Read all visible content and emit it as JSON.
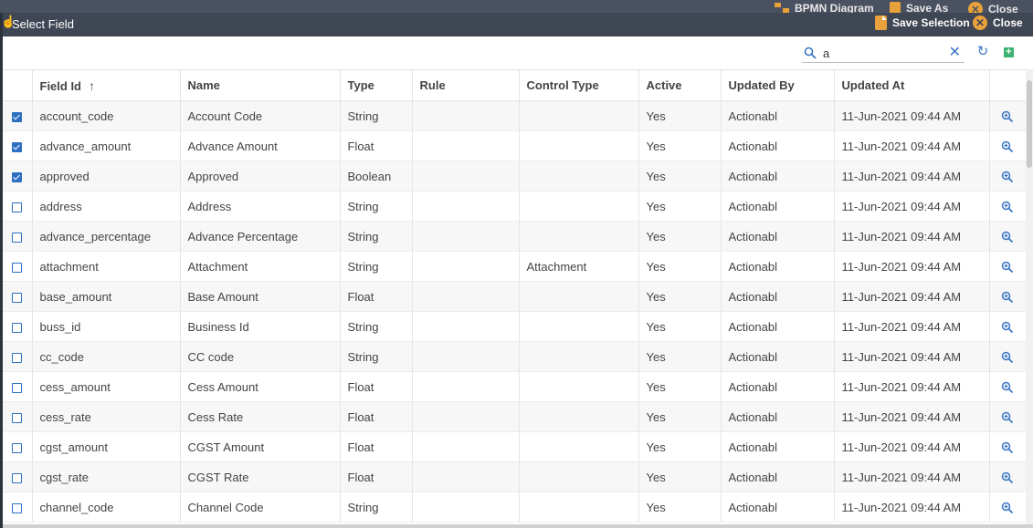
{
  "background_app": {
    "bpmn_label": "BPMN Diagram",
    "save_as_label": "Save As",
    "close_label": "Close"
  },
  "dialog": {
    "title": "Select Field",
    "save_selection_label": "Save Selection",
    "close_label": "Close"
  },
  "toolbar": {
    "search_value": "a"
  },
  "table": {
    "columns": [
      "Field Id",
      "Name",
      "Type",
      "Rule",
      "Control Type",
      "Active",
      "Updated By",
      "Updated At"
    ],
    "sorted_column": "Field Id",
    "sort_direction": "ascending",
    "rows": [
      {
        "checked": true,
        "field_id": "account_code",
        "name": "Account Code",
        "type": "String",
        "rule": "",
        "control_type": "",
        "active": "Yes",
        "updated_by": "Actionabl",
        "updated_at": "11-Jun-2021 09:44 AM"
      },
      {
        "checked": true,
        "field_id": "advance_amount",
        "name": "Advance Amount",
        "type": "Float",
        "rule": "",
        "control_type": "",
        "active": "Yes",
        "updated_by": "Actionabl",
        "updated_at": "11-Jun-2021 09:44 AM"
      },
      {
        "checked": true,
        "field_id": "approved",
        "name": "Approved",
        "type": "Boolean",
        "rule": "",
        "control_type": "",
        "active": "Yes",
        "updated_by": "Actionabl",
        "updated_at": "11-Jun-2021 09:44 AM"
      },
      {
        "checked": false,
        "field_id": "address",
        "name": "Address",
        "type": "String",
        "rule": "",
        "control_type": "",
        "active": "Yes",
        "updated_by": "Actionabl",
        "updated_at": "11-Jun-2021 09:44 AM"
      },
      {
        "checked": false,
        "field_id": "advance_percentage",
        "name": "Advance Percentage",
        "type": "String",
        "rule": "",
        "control_type": "",
        "active": "Yes",
        "updated_by": "Actionabl",
        "updated_at": "11-Jun-2021 09:44 AM"
      },
      {
        "checked": false,
        "field_id": "attachment",
        "name": "Attachment",
        "type": "String",
        "rule": "",
        "control_type": "Attachment",
        "active": "Yes",
        "updated_by": "Actionabl",
        "updated_at": "11-Jun-2021 09:44 AM"
      },
      {
        "checked": false,
        "field_id": "base_amount",
        "name": "Base Amount",
        "type": "Float",
        "rule": "",
        "control_type": "",
        "active": "Yes",
        "updated_by": "Actionabl",
        "updated_at": "11-Jun-2021 09:44 AM"
      },
      {
        "checked": false,
        "field_id": "buss_id",
        "name": "Business Id",
        "type": "String",
        "rule": "",
        "control_type": "",
        "active": "Yes",
        "updated_by": "Actionabl",
        "updated_at": "11-Jun-2021 09:44 AM"
      },
      {
        "checked": false,
        "field_id": "cc_code",
        "name": "CC code",
        "type": "String",
        "rule": "",
        "control_type": "",
        "active": "Yes",
        "updated_by": "Actionabl",
        "updated_at": "11-Jun-2021 09:44 AM"
      },
      {
        "checked": false,
        "field_id": "cess_amount",
        "name": "Cess Amount",
        "type": "Float",
        "rule": "",
        "control_type": "",
        "active": "Yes",
        "updated_by": "Actionabl",
        "updated_at": "11-Jun-2021 09:44 AM"
      },
      {
        "checked": false,
        "field_id": "cess_rate",
        "name": "Cess Rate",
        "type": "Float",
        "rule": "",
        "control_type": "",
        "active": "Yes",
        "updated_by": "Actionabl",
        "updated_at": "11-Jun-2021 09:44 AM"
      },
      {
        "checked": false,
        "field_id": "cgst_amount",
        "name": "CGST Amount",
        "type": "Float",
        "rule": "",
        "control_type": "",
        "active": "Yes",
        "updated_by": "Actionabl",
        "updated_at": "11-Jun-2021 09:44 AM"
      },
      {
        "checked": false,
        "field_id": "cgst_rate",
        "name": "CGST Rate",
        "type": "Float",
        "rule": "",
        "control_type": "",
        "active": "Yes",
        "updated_by": "Actionabl",
        "updated_at": "11-Jun-2021 09:44 AM"
      },
      {
        "checked": false,
        "field_id": "channel_code",
        "name": "Channel Code",
        "type": "String",
        "rule": "",
        "control_type": "",
        "active": "Yes",
        "updated_by": "Actionabl",
        "updated_at": "11-Jun-2021 09:44 AM"
      }
    ]
  },
  "colors": {
    "header_bg": "#3f4654",
    "accent_orange": "#e9a23b",
    "link_blue": "#3a76c4",
    "checkbox_blue": "#2c6fc1",
    "add_green": "#3cb371"
  },
  "icons": {
    "search": "search-icon",
    "clear": "close-icon",
    "refresh": "refresh-icon",
    "add": "plus-icon",
    "row_action": "zoom-in-icon"
  }
}
